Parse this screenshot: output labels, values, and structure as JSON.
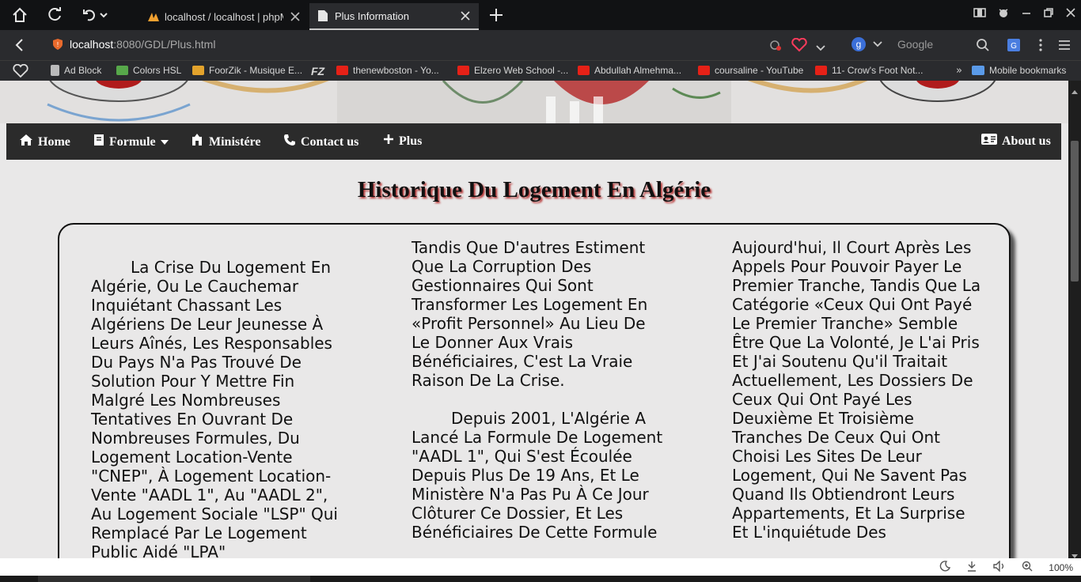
{
  "browser": {
    "tabs": [
      {
        "title": "localhost / localhost | phpMy",
        "active": false
      },
      {
        "title": "Plus Information",
        "active": true
      }
    ],
    "url": {
      "host": "localhost",
      "path": ":8080/GDL/Plus.html"
    },
    "search_engine": "Google",
    "bookmarks": [
      {
        "label": "Ad Block",
        "icon": "page-icon"
      },
      {
        "label": "Colors HSL",
        "icon": "colors-icon"
      },
      {
        "label": "FoorZik - Musique E...",
        "icon": "foorzik-icon"
      },
      {
        "label": "",
        "icon": "filezilla-icon"
      },
      {
        "label": "thenewboston - Yo...",
        "icon": "youtube-icon"
      },
      {
        "label": "Elzero Web School -...",
        "icon": "youtube-icon"
      },
      {
        "label": "Abdullah Almehma...",
        "icon": "youtube-icon"
      },
      {
        "label": "coursaline - YouTube",
        "icon": "youtube-icon"
      },
      {
        "label": "11- Crow's Foot Not...",
        "icon": "youtube-icon"
      }
    ],
    "mobile_bookmarks": "Mobile bookmarks",
    "zoom": "100%"
  },
  "nav": {
    "home": "Home",
    "formule": "Formule",
    "ministere": "Ministére",
    "contact": "Contact us",
    "plus": "Plus",
    "about": "About us"
  },
  "page": {
    "title": "Historique Du Logement En Algérie",
    "col1_p1": "La Crise Du Logement En Algérie, Ou Le Cauchemar Inquiétant Chassant Les Algériens De Leur Jeunesse À Leurs Aînés, Les Responsables Du Pays N'a Pas Trouvé De Solution Pour Y Mettre Fin Malgré Les Nombreuses Tentatives En Ouvrant De Nombreuses Formules, Du Logement Location-Vente \"CNEP\", À Logement Location-Vente \"AADL 1\", Au \"AADL 2\", Au Logement Sociale \"LSP\" Qui Remplacé Par Le Logement Public Aidé \"LPA\"",
    "col2_p1": "Tandis Que D'autres Estiment Que La Corruption Des Gestionnaires Qui Sont Transformer Les Logement En «Profit Personnel» Au Lieu De Le Donner Aux Vrais Bénéficiaires, C'est La Vraie Raison De La Crise.",
    "col2_p2": "Depuis 2001, L'Algérie A Lancé La Formule De Logement \"AADL 1\", Qui S'est Écoulée Depuis Plus De 19 Ans, Et Le Ministère N'a Pas Pu À Ce Jour Clôturer Ce Dossier, Et Les Bénéficiaires De Cette Formule",
    "col3_p1": "Aujourd'hui, Il Court Après Les Appels Pour Pouvoir Payer Le Premier Tranche, Tandis Que La Catégorie «Ceux Qui Ont Payé Le Premier Tranche» Semble Être Que La Volonté, Je L'ai Pris Et J'ai Soutenu Qu'il Traitait Actuellement, Les Dossiers De Ceux Qui Ont Payé Les Deuxième Et Troisième Tranches De Ceux Qui Ont Choisi Les Sites De Leur Logement, Qui Ne Savent Pas Quand Ils Obtiendront Leurs Appartements, Et La Surprise Et L'inquiétude Des"
  },
  "colors": {
    "navbar_bg": "#2b2b2b",
    "page_bg": "#e9e8e8",
    "title_shadow": "#b83a3a",
    "youtube_red": "#e62117"
  }
}
